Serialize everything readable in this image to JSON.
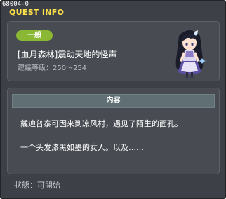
{
  "window": {
    "id_label": "68004-0",
    "title": "QUEST INFO"
  },
  "quest": {
    "category": "一般",
    "name": "[血月森林]震动天地的怪声",
    "level_range": "建議等级：250～254"
  },
  "content": {
    "header": "内容",
    "lines": [
      "戴迪普泰可因来到凉风村，遇见了陌生的面孔。",
      "一个头发漆黑如墨的女人。以及……"
    ]
  },
  "status": "狀態：可開始",
  "colors": {
    "window_bg": "#3d4046",
    "panel_bg": "#484c52",
    "title": "#ffe24a",
    "category_pill": "#8ab834",
    "content_header_bg": "#5f6f74"
  },
  "icons": {
    "npc": "npc-portrait-dark-haired-woman"
  }
}
